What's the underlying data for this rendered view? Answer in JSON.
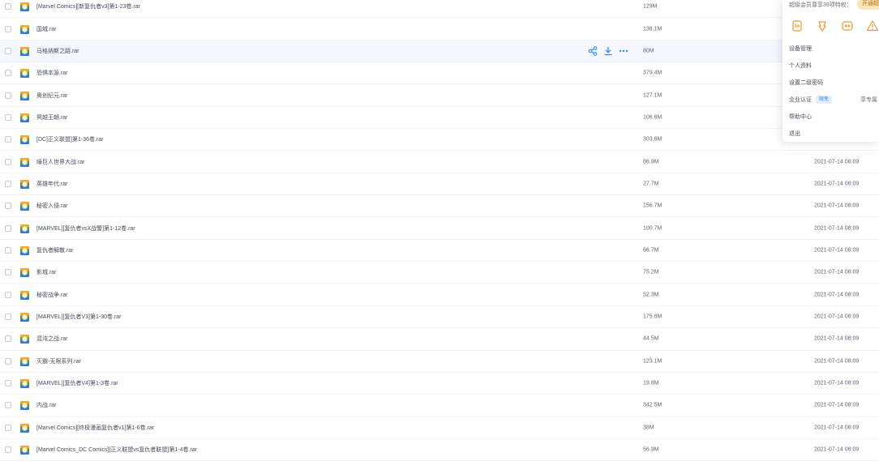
{
  "files": [
    {
      "name": "[Marvel Comics][新复仇者v3]第1-23卷.rar",
      "size": "129M",
      "date": ""
    },
    {
      "name": "国城.rar",
      "size": "138.1M",
      "date": ""
    },
    {
      "name": "马格纳斯之路.rar",
      "size": "80M",
      "date": ""
    },
    {
      "name": "恐惧本源.rar",
      "size": "379.4M",
      "date": ""
    },
    {
      "name": "奥创纪元.rar",
      "size": "127.1M",
      "date": ""
    },
    {
      "name": "冥越王朝.rar",
      "size": "106.6M",
      "date": ""
    },
    {
      "name": "[DC]正义联盟]第1-36卷.rar",
      "size": "303.6M",
      "date": ""
    },
    {
      "name": "綠巨人世界大战.rar",
      "size": "86.9M",
      "date": "2021-07-14 08:09"
    },
    {
      "name": "英雄年代.rar",
      "size": "27.7M",
      "date": "2021-07-14 08:09"
    },
    {
      "name": "秘密入侵.rar",
      "size": "156.7M",
      "date": "2021-07-14 08:09"
    },
    {
      "name": "[MARVEL][复仇者vsX战警]第1-12卷.rar",
      "size": "100.7M",
      "date": "2021-07-14 08:09"
    },
    {
      "name": "复仇者解散.rar",
      "size": "66.7M",
      "date": "2021-07-14 08:09"
    },
    {
      "name": "影城.rar",
      "size": "75.2M",
      "date": "2021-07-14 08:09"
    },
    {
      "name": "秘密战争.rar",
      "size": "52.3M",
      "date": "2021-07-14 08:09"
    },
    {
      "name": "[MARVEL][复仇者V3]第1-30卷.rar",
      "size": "175.6M",
      "date": "2021-07-14 08:09"
    },
    {
      "name": "混沌之战.rar",
      "size": "44.5M",
      "date": "2021-07-14 08:09"
    },
    {
      "name": "灭霸-无限系列.rar",
      "size": "123.1M",
      "date": "2021-07-14 08:09"
    },
    {
      "name": "[MARVEL][复仇者V4]第1-3卷.rar",
      "size": "19.8M",
      "date": "2021-07-14 08:09"
    },
    {
      "name": "内战.rar",
      "size": "342.5M",
      "date": "2021-07-14 08:09"
    },
    {
      "name": "[Marvel Comics][终极漫画复仇者v1]第1-6卷.rar",
      "size": "38M",
      "date": "2021-07-14 08:09"
    },
    {
      "name": "[Marvel Comics_DC Comics][正义联盟vs复仇者联盟]第1-4卷.rar",
      "size": "56.9M",
      "date": "2021-07-14 08:09"
    }
  ],
  "row_actions": [
    "share-icon",
    "download-icon",
    "more-icon"
  ],
  "popup": {
    "vip_text": "超级会员尊享39项特权：",
    "open_button": "开通超",
    "perk_icons": [
      "speed-icon",
      "download-speed-icon",
      "video-icon",
      "info-icon"
    ],
    "menu": {
      "device": "设备管理",
      "profile": "个人资料",
      "second_password": "设置二级密码",
      "enterprise": "企业认证",
      "enterprise_badge": "限免",
      "enterprise_extra": "享专属",
      "help": "帮助中心",
      "logout": "退出"
    }
  },
  "colors": {
    "accent": "#3a86f0",
    "hover_row": "#f4f8fe",
    "text": "#454d5a"
  }
}
